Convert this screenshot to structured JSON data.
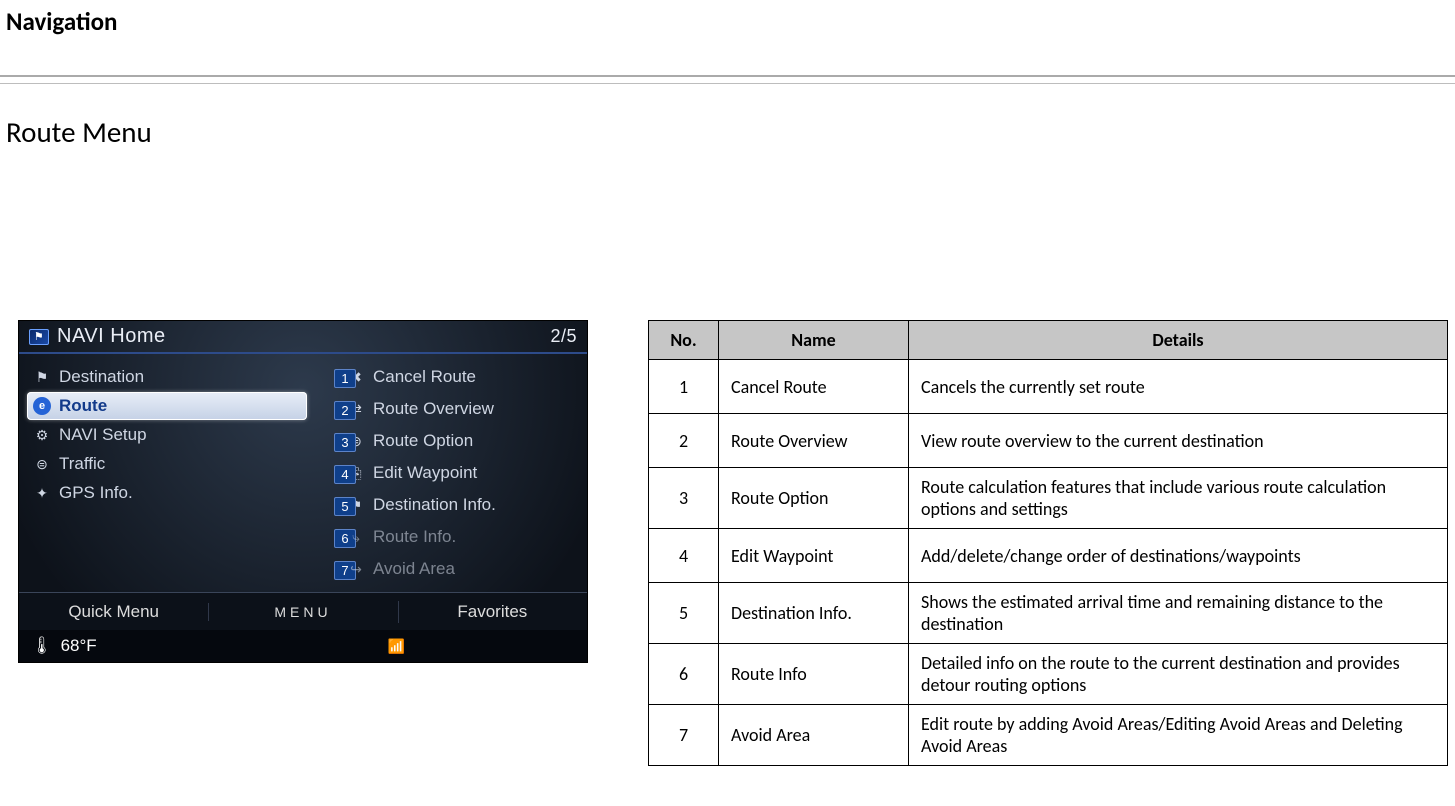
{
  "page": {
    "heading": "Navigation",
    "section_title": "Route Menu"
  },
  "device": {
    "title": "NAVI Home",
    "page_indicator": "2/5",
    "left_menu": [
      {
        "label": "Destination",
        "icon": "⚑"
      },
      {
        "label": "Route",
        "icon": "e",
        "active": true
      },
      {
        "label": "NAVI Setup",
        "icon": "⚙"
      },
      {
        "label": "Traffic",
        "icon": "⊜"
      },
      {
        "label": "GPS Info.",
        "icon": "✦"
      }
    ],
    "right_menu": [
      {
        "num": "1",
        "label": "Cancel Route",
        "icon": "✖"
      },
      {
        "num": "2",
        "label": "Route Overview",
        "icon": "⇄"
      },
      {
        "num": "3",
        "label": "Route Option",
        "icon": "⊜"
      },
      {
        "num": "4",
        "label": "Edit Waypoint",
        "icon": "⎘"
      },
      {
        "num": "5",
        "label": "Destination Info.",
        "icon": "⚑"
      },
      {
        "num": "6",
        "label": "Route Info.",
        "icon": "⤷",
        "dimmed": true
      },
      {
        "num": "7",
        "label": "Avoid Area",
        "icon": "↪",
        "dimmed": true
      }
    ],
    "footer": {
      "left": "Quick Menu",
      "center": "MENU",
      "right": "Favorites"
    },
    "status": {
      "temp": "68°F"
    }
  },
  "table": {
    "headers": {
      "no": "No.",
      "name": "Name",
      "details": "Details"
    },
    "rows": [
      {
        "no": "1",
        "name": "Cancel Route",
        "details": "Cancels the currently set route"
      },
      {
        "no": "2",
        "name": "Route Overview",
        "details": "View route overview to the current destination"
      },
      {
        "no": "3",
        "name": "Route Option",
        "details": "Route calculation features that include various route calculation options and settings"
      },
      {
        "no": "4",
        "name": "Edit Waypoint",
        "details": "Add/delete/change order of destinations/waypoints"
      },
      {
        "no": "5",
        "name": "Destination Info.",
        "details": "Shows the estimated arrival time and remaining distance to the destination"
      },
      {
        "no": "6",
        "name": "Route Info",
        "details": "Detailed info on the route to the current destination and provides detour routing options"
      },
      {
        "no": "7",
        "name": "Avoid Area",
        "details": "Edit route by adding Avoid Areas/Editing Avoid Areas and Deleting Avoid Areas"
      }
    ]
  }
}
